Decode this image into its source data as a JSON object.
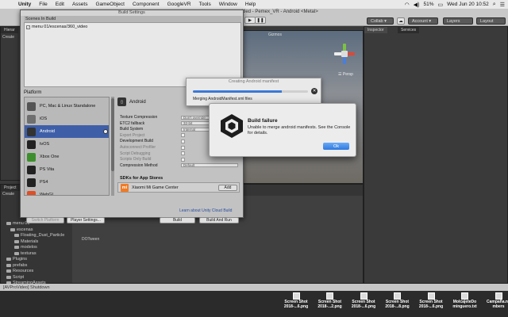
{
  "menubar": {
    "items": [
      "Unity",
      "File",
      "Edit",
      "Assets",
      "GameObject",
      "Component",
      "GoogleVR",
      "Tools",
      "Window",
      "Help"
    ],
    "battery": "51%",
    "clock": "Wed Jun 20  10:52"
  },
  "toolbar": {
    "window_title": "ntitled - Pemex_VR - Android <Metal>",
    "collab": "Collab ▾",
    "account": "Account ▾",
    "layers": "Layers",
    "layout": "Layout"
  },
  "panels": {
    "hierarchy_tab": "Hierar",
    "hierarchy_create": "Create",
    "scene_gizmo_label": "Gizmos",
    "persp_label": "☰ Persp",
    "inspector_tab": "Inspector",
    "services_tab": "Services",
    "project_tab": "Project",
    "project_create": "Create",
    "project_asset": "DOTween"
  },
  "project_tree": [
    "menu 01",
    "escenas",
    "Floating_Dust_Particle",
    "Materials",
    "modelos",
    "texturas",
    "Plugins",
    "prefabs",
    "Resources",
    "Script",
    "StreamingAssets"
  ],
  "status_bar": "[AVProVideo] Shutdown",
  "build_settings": {
    "title": "Build Settings",
    "scenes_header": "Scenes In Build",
    "scene_row": "menu 01/escenas/360_video",
    "platform_header": "Platform",
    "platforms": [
      {
        "name": "PC, Mac & Linux Standalone",
        "icon": "pc-mac-linux-icon",
        "color": "#555555"
      },
      {
        "name": "iOS",
        "icon": "ios-icon",
        "color": "#6f6f6f"
      },
      {
        "name": "Android",
        "icon": "android-icon",
        "color": "#333333"
      },
      {
        "name": "tvOS",
        "icon": "tvos-icon",
        "color": "#222222"
      },
      {
        "name": "Xbox One",
        "icon": "xbox-icon",
        "color": "#3d8f2e"
      },
      {
        "name": "PS Vita",
        "icon": "ps-vita-icon",
        "color": "#222222"
      },
      {
        "name": "PS4",
        "icon": "ps4-icon",
        "color": "#222222"
      },
      {
        "name": "WebGL",
        "icon": "webgl-html5-icon",
        "color": "#e04e25"
      }
    ],
    "selected_platform": "Android",
    "android_title": "Android",
    "settings": [
      {
        "label": "Texture Compression",
        "value": "Don't override",
        "muted": false
      },
      {
        "label": "ETC2 fallback",
        "value": "32-bit",
        "muted": false
      },
      {
        "label": "Build System",
        "value": "Internal",
        "muted": false
      },
      {
        "label": "Export Project",
        "value": "",
        "muted": true
      },
      {
        "label": "Development Build",
        "value": "",
        "muted": false
      },
      {
        "label": "Autoconnect Profiler",
        "value": "",
        "muted": true
      },
      {
        "label": "Script Debugging",
        "value": "",
        "muted": true
      },
      {
        "label": "Scripts Only Build",
        "value": "",
        "muted": true
      },
      {
        "label": "Compression Method",
        "value": "Default",
        "muted": false
      }
    ],
    "sdk_title": "SDKs for App Stores",
    "sdk_store": "Xiaomi Mi Game Center",
    "sdk_add": "Add",
    "cloud_link": "Learn about Unity Cloud Build",
    "switch_platform": "Switch Platform",
    "player_settings": "Player Settings...",
    "build": "Build",
    "build_and_run": "Build And Run"
  },
  "progress_dialog": {
    "title": "Creating Android manifest",
    "status": "Merging AndroidManifest.xml files",
    "progress_fraction": 0.77
  },
  "alert": {
    "title": "Build failure",
    "message": "Unable to merge android manifests. See the Console for details.",
    "ok": "Ok"
  },
  "desktop_files": [
    {
      "line1": "Screen Shot",
      "line2": "2018-...6.png"
    },
    {
      "line1": "Screen Shot",
      "line2": "2018-...2.png"
    },
    {
      "line1": "Screen Shot",
      "line2": "2018-...6.png"
    },
    {
      "line1": "Screen Shot",
      "line2": "2018-...8.png"
    },
    {
      "line1": "Screen Shot",
      "line2": "2018-...6.png"
    },
    {
      "line1": "MolcajeteDo",
      "line2": "minguero.txt"
    },
    {
      "line1": "Campaña.nu",
      "line2": "mbers"
    }
  ],
  "colors": {
    "selection_blue": "#3e5fa8",
    "progress_blue": "#3a79d8",
    "ok_button_blue": "#2d79e0",
    "xiaomi_orange": "#f27a23"
  }
}
